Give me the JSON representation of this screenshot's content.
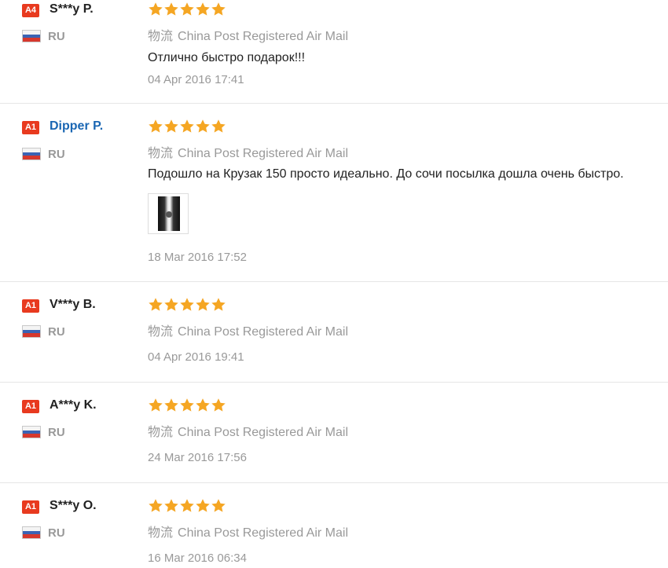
{
  "reviews": [
    {
      "badge": "A4",
      "name": "S***y P.",
      "country": "RU",
      "shipping_cn": "物流",
      "shipping": "China Post Registered Air Mail",
      "text": "Отлично быстро подарок!!!",
      "date": "04 Apr 2016 17:41",
      "stars": 5
    },
    {
      "badge": "A1",
      "name": "Dipper P.",
      "country": "RU",
      "shipping_cn": "物流",
      "shipping": "China Post Registered Air Mail",
      "text": "Подошло на Крузак 150 просто идеально. До сочи посылка дошла очень быстро.",
      "date": "18 Mar 2016 17:52",
      "stars": 5
    },
    {
      "badge": "A1",
      "name": "V***y B.",
      "country": "RU",
      "shipping_cn": "物流",
      "shipping": "China Post Registered Air Mail",
      "text": "",
      "date": "04 Apr 2016 19:41",
      "stars": 5
    },
    {
      "badge": "A1",
      "name": "A***y K.",
      "country": "RU",
      "shipping_cn": "物流",
      "shipping": "China Post Registered Air Mail",
      "text": "",
      "date": "24 Mar 2016 17:56",
      "stars": 5
    },
    {
      "badge": "A1",
      "name": "S***y O.",
      "country": "RU",
      "shipping_cn": "物流",
      "shipping": "China Post Registered Air Mail",
      "text": "",
      "date": "16 Mar 2016 06:34",
      "stars": 5
    }
  ],
  "colors": {
    "badge": "#e83a1f",
    "star": "#f5a623",
    "link": "#1a66b3"
  }
}
